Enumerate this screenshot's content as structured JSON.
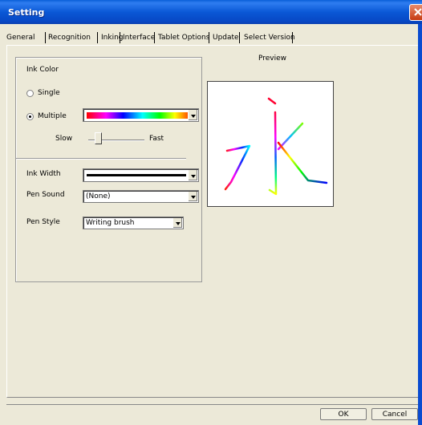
{
  "window": {
    "title": "Setting"
  },
  "tabs": [
    {
      "label": "General"
    },
    {
      "label": "Recognition"
    },
    {
      "label": "Inking",
      "active": true
    },
    {
      "label": "Interface"
    },
    {
      "label": "Tablet Options"
    },
    {
      "label": "Update"
    },
    {
      "label": "Select Version"
    }
  ],
  "ink_color": {
    "heading": "Ink Color",
    "single_label": "Single",
    "multiple_label": "Multiple",
    "selected": "Multiple",
    "speed": {
      "slow_label": "Slow",
      "fast_label": "Fast",
      "value": 0.15
    }
  },
  "ink_width": {
    "label": "Ink Width"
  },
  "pen_sound": {
    "label": "Pen Sound",
    "value": "(None)"
  },
  "pen_style": {
    "label": "Pen Style",
    "value": "Writing brush"
  },
  "preview": {
    "label": "Preview",
    "character": "永"
  },
  "buttons": {
    "ok": "OK",
    "cancel": "Cancel"
  },
  "colors": {
    "titlebar": "#0a58d6",
    "dialog_bg": "#ece9d8"
  }
}
